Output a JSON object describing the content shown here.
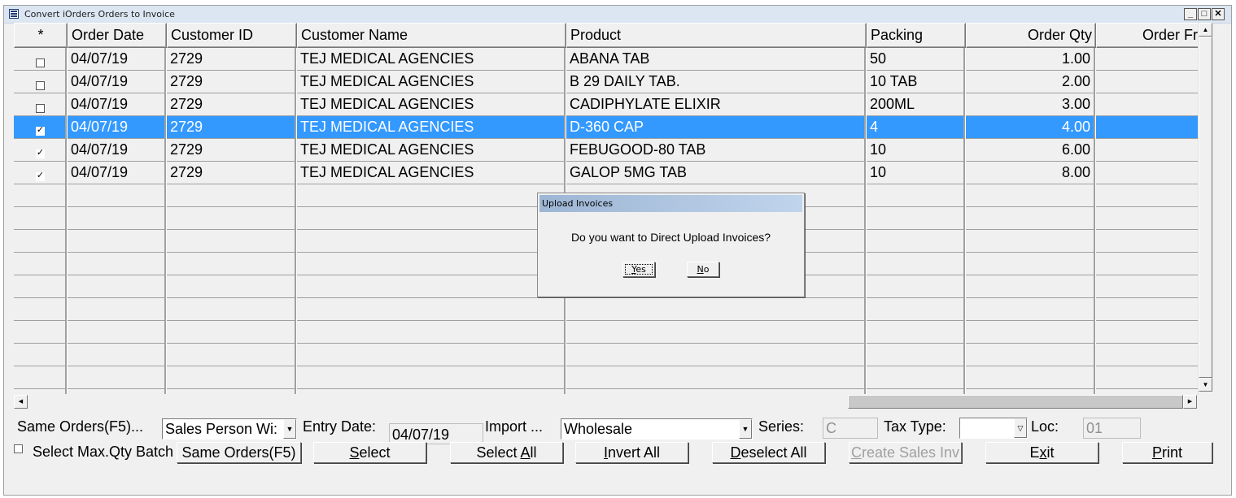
{
  "window": {
    "title": "Convert iOrders Orders to Invoice",
    "controls": {
      "minimize": "_",
      "maximize": "□",
      "close": "✕"
    }
  },
  "grid": {
    "columns": [
      {
        "label": "*",
        "align": "center"
      },
      {
        "label": "Order Date",
        "align": "left"
      },
      {
        "label": "Customer ID",
        "align": "left"
      },
      {
        "label": "Customer Name",
        "align": "left"
      },
      {
        "label": "Product",
        "align": "left"
      },
      {
        "label": "Packing",
        "align": "left"
      },
      {
        "label": "Order Qty",
        "align": "right"
      },
      {
        "label": "Order Fre",
        "align": "right"
      }
    ],
    "rows": [
      {
        "checked": false,
        "order_date": "04/07/19",
        "customer_id": "2729",
        "customer_name": "TEJ MEDICAL AGENCIES",
        "product": "ABANA TAB",
        "packing": "50",
        "order_qty": "1.00",
        "order_free": "",
        "selected": false
      },
      {
        "checked": false,
        "order_date": "04/07/19",
        "customer_id": "2729",
        "customer_name": "TEJ MEDICAL AGENCIES",
        "product": "B 29 DAILY TAB.",
        "packing": "10 TAB",
        "order_qty": "2.00",
        "order_free": "",
        "selected": false
      },
      {
        "checked": false,
        "order_date": "04/07/19",
        "customer_id": "2729",
        "customer_name": "TEJ MEDICAL AGENCIES",
        "product": "CADIPHYLATE ELIXIR",
        "packing": "200ML",
        "order_qty": "3.00",
        "order_free": "",
        "selected": false
      },
      {
        "checked": true,
        "order_date": "04/07/19",
        "customer_id": "2729",
        "customer_name": "TEJ MEDICAL AGENCIES",
        "product": "D-360 CAP",
        "packing": "4",
        "order_qty": "4.00",
        "order_free": "",
        "selected": true
      },
      {
        "checked": true,
        "order_date": "04/07/19",
        "customer_id": "2729",
        "customer_name": "TEJ MEDICAL AGENCIES",
        "product": "FEBUGOOD-80 TAB",
        "packing": "10",
        "order_qty": "6.00",
        "order_free": "",
        "selected": false
      },
      {
        "checked": true,
        "order_date": "04/07/19",
        "customer_id": "2729",
        "customer_name": "TEJ MEDICAL AGENCIES",
        "product": "GALOP 5MG TAB",
        "packing": "10",
        "order_qty": "8.00",
        "order_free": "",
        "selected": false
      }
    ],
    "check_glyph": "✓",
    "selection_color": "#3399ff"
  },
  "controls": {
    "same_orders_label": "Same Orders(F5)...",
    "same_orders_select": "Sales Person Wi:",
    "entry_date_label": "Entry Date:",
    "entry_date_value": "04/07/19",
    "import_label": "Import ...",
    "import_select": "Wholesale",
    "series_label": "Series:",
    "series_value": "C",
    "tax_type_label": "Tax Type:",
    "tax_type_value": "",
    "loc_label": "Loc:",
    "loc_value": "01",
    "select_max_qty_label": "Select Max.Qty Batch",
    "select_max_qty_checked": false
  },
  "buttons": {
    "same_orders": "Same Orders(F5)",
    "select": {
      "pre": "",
      "u": "S",
      "post": "elect"
    },
    "select_all": {
      "pre": "Select ",
      "u": "A",
      "post": "ll"
    },
    "invert_all": {
      "pre": "",
      "u": "I",
      "post": "nvert All"
    },
    "deselect_all": {
      "pre": "",
      "u": "D",
      "post": "eselect All"
    },
    "create_sales_inv": {
      "pre": "",
      "u": "C",
      "post": "reate Sales Inv"
    },
    "exit": {
      "pre": "E",
      "u": "x",
      "post": "it"
    },
    "print": {
      "pre": "",
      "u": "P",
      "post": "rint"
    }
  },
  "dialog": {
    "title": "Upload Invoices",
    "message": "Do you want to Direct Upload Invoices?",
    "yes": {
      "u": "Y",
      "post": "es"
    },
    "no": {
      "u": "N",
      "post": "o"
    }
  }
}
